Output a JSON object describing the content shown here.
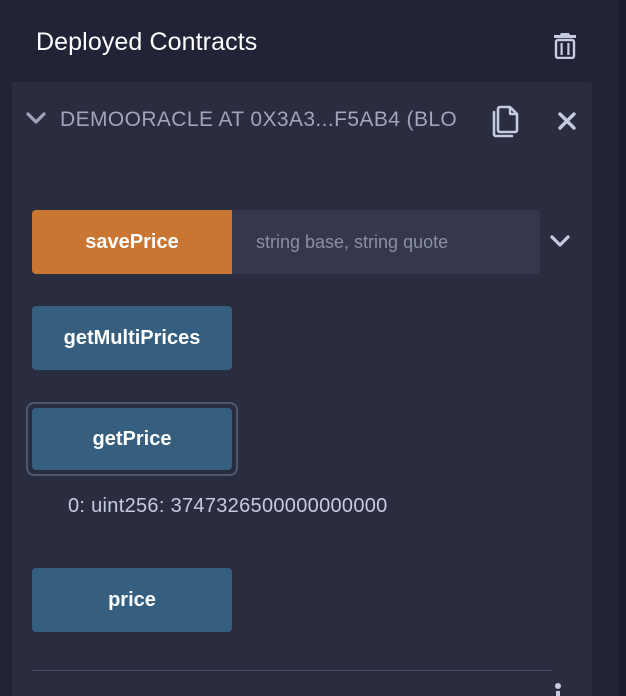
{
  "header": {
    "title": "Deployed Contracts",
    "trash_icon": "trash-icon"
  },
  "contract": {
    "name": "DEMOORACLE AT 0X3A3...F5AB4 (BLO",
    "expanded": true,
    "icons": [
      "chevron-down-icon",
      "copy-icon",
      "close-icon"
    ]
  },
  "functions": {
    "save_price": {
      "label": "savePrice",
      "placeholder": "string base, string quote",
      "color": "#ca7633"
    },
    "get_multi_prices": {
      "label": "getMultiPrices",
      "color": "#365f7f"
    },
    "get_price": {
      "label": "getPrice",
      "color": "#365f7f",
      "result": "0: uint256: 3747326500000000000"
    },
    "price": {
      "label": "price",
      "color": "#365f7f"
    }
  },
  "low_level": {
    "label": ""
  },
  "colors": {
    "background": "#222336",
    "panel": "#2a2c3f",
    "text": "#c7cbe0",
    "muted": "#a2a3bd"
  }
}
